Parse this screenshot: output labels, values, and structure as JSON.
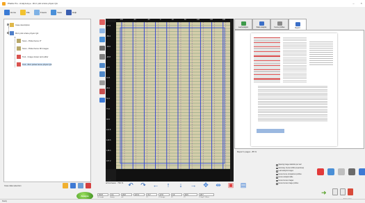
{
  "window": {
    "title": "PhaDe Pro - Analyze/eye - RLC prêt à faire physic QA",
    "controls": [
      "–",
      "×"
    ]
  },
  "toolbar": [
    {
      "label": "Home",
      "icon": "home-icon",
      "color": "#3a7bd5"
    },
    {
      "label": "File",
      "icon": "folder-icon",
      "color": "#f2c230"
    },
    {
      "label": "Freeze",
      "icon": "freeze-icon",
      "color": "#7fb2e5"
    },
    {
      "label": "Save",
      "icon": "save-icon",
      "color": "#4a90d9"
    },
    {
      "label": "Help",
      "icon": "help-icon",
      "color": "#3b5fb0"
    }
  ],
  "tree": {
    "root_label": "Case description",
    "items": [
      {
        "label": "RLC prêt à faire physic QA",
        "level": 1
      },
      {
        "label": "Scan - Picket fence 0°",
        "level": 2
      },
      {
        "label": "Scan - Picket fence 90 images",
        "level": 2
      },
      {
        "label": "Tool - Image viewer and editor",
        "level": 2
      },
      {
        "label": "Tool - RLC picket fence physic QA",
        "level": 2,
        "selected": true
      }
    ]
  },
  "left_bottom": {
    "label": "Case data selection"
  },
  "image": {
    "ruler_left": [
      "-77.2",
      "-58.4",
      "-39.6",
      "-20.8",
      "-2.0",
      "16.8",
      "35.6",
      "54.4",
      "73.2",
      "92.0",
      "110.8",
      "129.6",
      "148.4",
      "167.2"
    ],
    "ruler_top": [
      "-100",
      "-60",
      "-20",
      "0",
      "20",
      "60",
      "100",
      "140",
      "180"
    ],
    "footer_line1": "177.2",
    "footer_line2": "artical leave : 762 %"
  },
  "status_fields": {
    "values": [
      "78.07",
      "0.4",
      "26.8",
      "107.3",
      "79.7",
      "27.8",
      "6.6",
      "45.5",
      "28.7"
    ],
    "labels": [
      "Col angle",
      "Gantry",
      "coll",
      "",
      "Y1",
      "X1 Image",
      "X2",
      "Y2",
      "X Gap/Y Offset"
    ]
  },
  "analyze_button": "Analyze",
  "right_tabs": [
    {
      "label": "Leaf analysis",
      "color": "#3e9a4a"
    },
    {
      "label": "Stats analysis",
      "color": "#3b6fc7"
    },
    {
      "label": "Fence profiles",
      "color": "#8a8a8a"
    },
    {
      "label": "Report",
      "color": "#3b6fc7",
      "active": true
    }
  ],
  "report_footer": "Report 1 pages - 85 %",
  "checklist": [
    "Spacing image statistics per leaf",
    "Summary of pixel shifts (mean/max)",
    "Leaf analysis images",
    "Fence fence comparison profiles",
    "Fence analysis table",
    "Fence fences images",
    "Fence fences image profiles"
  ],
  "right_icons": [
    {
      "name": "settings-icon",
      "color": "#e23a3a"
    },
    {
      "name": "search-icon",
      "color": "#4a8fd6"
    },
    {
      "name": "document-icon",
      "color": "#bfbfbf"
    },
    {
      "name": "edit-icon",
      "color": "#6b6b6b"
    },
    {
      "name": "export-icon",
      "color": "#3e7ad4"
    }
  ],
  "sample_name": "Scan name",
  "bottom_bar_label": "Ready"
}
